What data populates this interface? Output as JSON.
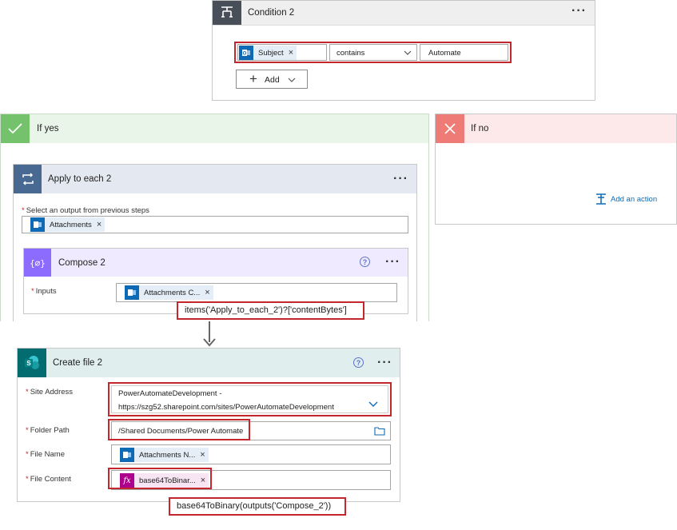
{
  "condition": {
    "title": "Condition 2",
    "subject_token": "Subject",
    "operator": "contains",
    "value": "Automate",
    "add_label": "Add"
  },
  "if_yes": {
    "title": "If yes"
  },
  "if_no": {
    "title": "If no",
    "add_action_label": "Add an action"
  },
  "apply_each": {
    "title": "Apply to each 2",
    "select_label": "Select an output from previous steps",
    "attachments_token": "Attachments"
  },
  "compose": {
    "title": "Compose 2",
    "inputs_label": "Inputs",
    "inputs_token": "Attachments C...",
    "expression_callout": "items('Apply_to_each_2')?['contentBytes']"
  },
  "create_file": {
    "title": "Create file 2",
    "site_address_label": "Site Address",
    "site_address_line1": "PowerAutomateDevelopment -",
    "site_address_line2": "https://szg52.sharepoint.com/sites/PowerAutomateDevelopment",
    "folder_path_label": "Folder Path",
    "folder_path_value": "/Shared Documents/Power Automate",
    "file_name_label": "File Name",
    "file_name_token": "Attachments N...",
    "file_content_label": "File Content",
    "file_content_token": "base64ToBinar...",
    "expression_callout": "base64ToBinary(outputs('Compose_2'))"
  },
  "icons": [
    "condition-icon",
    "outlook-icon",
    "check-icon",
    "x-icon",
    "loop-icon",
    "compose-icon",
    "sharepoint-icon",
    "function-icon",
    "folder-icon",
    "add-action-icon",
    "help-icon",
    "more-icon",
    "chevron-down-icon",
    "arrow-down-icon"
  ],
  "colors": {
    "condition_header": "#484f58",
    "yes_header": "#e9f5e9",
    "yes_icon": "#75c26d",
    "no_header": "#fde9e9",
    "no_icon": "#ef7b76",
    "loop_header": "#486991",
    "compose_header": "#8c6cff",
    "sharepoint_header": "#036c70",
    "outlook_token": "#0f6ab5",
    "function_token": "#ad008c",
    "callout_border": "#c4262e",
    "link": "#0f6ab5"
  }
}
